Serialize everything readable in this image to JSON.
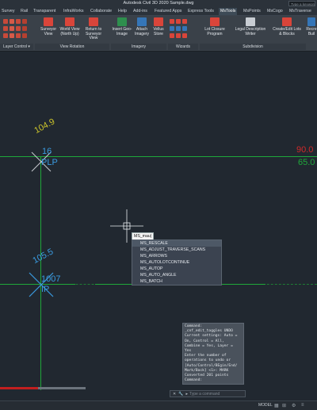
{
  "app": {
    "title": "Autodesk Civil 3D 2020   Sample.dwg",
    "search_placeholder": "Type a keyword"
  },
  "tabs": [
    "Survey",
    "Rail",
    "Transparent",
    "InfraWorks",
    "Collaborate",
    "Help",
    "Add-ins",
    "Featured Apps",
    "Express Tools",
    "MsTools",
    "MsPoints",
    "MsCogo",
    "MsTraverse"
  ],
  "active_tab": "MsTools",
  "ribbon": {
    "buttons": {
      "surveyor_view": "Surveyor View",
      "world_view": "World View (North Up)",
      "return_to_surveyor": "Return to Surveyor View",
      "insert_geo_image": "Insert Geo-Image",
      "attach_imagery": "Attach Imagery",
      "vellus_store": "Vellus Store",
      "lot_closure": "Lot Closure Program",
      "legal_description": "Legal Description Writer",
      "create_edit_lots": "Create/Edit Lots & Blocks",
      "recreate_build": "Recre Buil"
    },
    "panels": [
      "Layer Control ▾",
      "View Rotation",
      "Imagery",
      "Wizards",
      "Subdivision"
    ]
  },
  "drawing": {
    "labels": {
      "elev_a": "104.9",
      "pt_a": "16",
      "code_a": "PLP",
      "elev_b": "105.5",
      "pt_b": "1007",
      "code_b": "IP",
      "right_a": "90.0",
      "right_b": "65.0"
    }
  },
  "command": {
    "typed": "MS_mau|",
    "suggestions": [
      "MS_RESCALE",
      "MS_ADJUST_TRAVERSE_SCANS",
      "MS_ARROWS",
      "MS_AUTOLOTCONTINUE",
      "MS_AUTOP",
      "MS_AUTO_ANGLE",
      "MS_BATCH"
    ],
    "history": [
      "Command:",
      "_cnf_edit_toggles UNDO",
      "Current settings: Auto =",
      "On, Control = All,",
      "Combine = Yes, Layer =",
      "Yes",
      "Enter the number of",
      "operations to undo or",
      "[Auto/Control/BEgin/End/",
      "Mark/Back] <1>: MARK",
      "Converted 201 points",
      "Command:"
    ],
    "prompt_placeholder": "Type a command"
  },
  "status": {
    "model_label": "MODEL"
  },
  "colors": {
    "background": "#212830",
    "green_line": "#1fa83a",
    "yellow_label": "#c9c22b",
    "cyan_label": "#3a9be0",
    "red_label": "#d12a2a"
  }
}
